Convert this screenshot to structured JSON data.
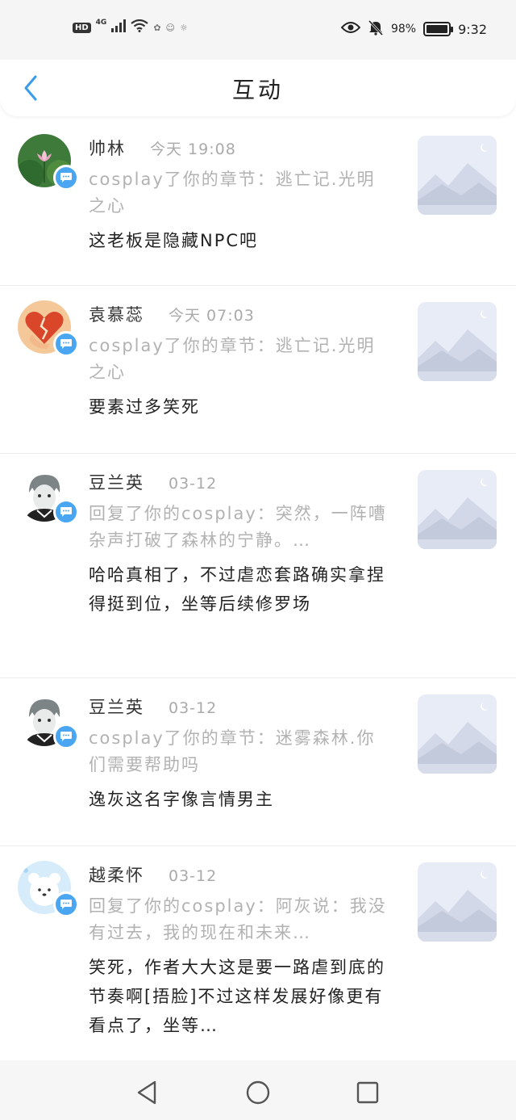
{
  "status_bar": {
    "hd": "HD",
    "network": "4G",
    "battery_text": "98%",
    "battery_level": 0.98,
    "time": "9:32"
  },
  "header": {
    "title": "互动"
  },
  "items": [
    {
      "username": "帅林",
      "time": "今天 19:08",
      "context": "cosplay了你的章节：逃亡记.光明之心",
      "message": "这老板是隐藏NPC吧"
    },
    {
      "username": "袁慕蕊",
      "time": "今天 07:03",
      "context": "cosplay了你的章节：逃亡记.光明之心",
      "message": "要素过多笑死"
    },
    {
      "username": "豆兰英",
      "time": "03-12",
      "context": "回复了你的cosplay：突然，一阵嘈杂声打破了森林的宁静。…",
      "message": "哈哈真相了，不过虐恋套路确实拿捏得挺到位，坐等后续修罗场"
    },
    {
      "username": "豆兰英",
      "time": "03-12",
      "context": "cosplay了你的章节：迷雾森林.你们需要帮助吗",
      "message": "逸灰这名字像言情男主"
    },
    {
      "username": "越柔怀",
      "time": "03-12",
      "context": "回复了你的cosplay：阿灰说：我没有过去，我的现在和未来…",
      "message": "笑死，作者大大这是要一路虐到底的节奏啊[捂脸]不过这样发展好像更有看点了，坐等…"
    }
  ],
  "colors": {
    "accent": "#4ba6f2",
    "secondary_text": "#b2b2b2"
  }
}
